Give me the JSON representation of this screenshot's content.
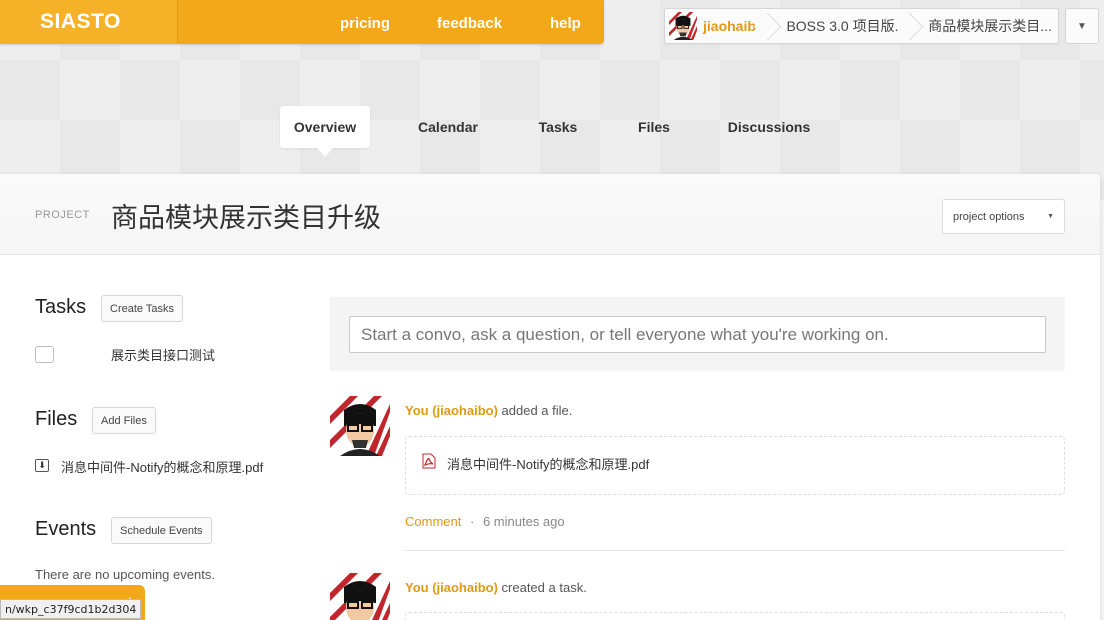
{
  "app": {
    "logo": "SIASTO",
    "nav": [
      "pricing",
      "feedback",
      "help"
    ]
  },
  "breadcrumb": {
    "user": "jiaohaibo",
    "project_group": "BOSS 3.0 项目版...",
    "project": "商品模块展示类目..."
  },
  "tabs": [
    "Overview",
    "Calendar",
    "Tasks",
    "Files",
    "Discussions"
  ],
  "active_tab": "Overview",
  "project": {
    "label": "PROJECT",
    "title": "商品模块展示类目升级",
    "options_label": "project options"
  },
  "sidebar": {
    "tasks": {
      "title": "Tasks",
      "button": "Create Tasks",
      "items": [
        "展示类目接口测试"
      ]
    },
    "files": {
      "title": "Files",
      "button": "Add Files",
      "items": [
        "消息中间件-Notify的概念和原理.pdf"
      ]
    },
    "events": {
      "title": "Events",
      "button": "Schedule Events",
      "empty": "There are no upcoming events."
    }
  },
  "composer": {
    "placeholder": "Start a convo, ask a question, or tell everyone what you're working on."
  },
  "feed": [
    {
      "actor": "You (jiaohaibo)",
      "action": " added a file.",
      "attachment": "消息中间件-Notify的概念和原理.pdf",
      "comment_label": "Comment",
      "separator": "·",
      "time": "6 minutes ago"
    },
    {
      "actor": "You (jiaohaibo)",
      "action": " created a task."
    }
  ],
  "status_bar": {
    "url": "n/wkp_c37f9cd1b2d304"
  },
  "colors": {
    "accent": "#f3a81a",
    "link": "#e29a10"
  }
}
